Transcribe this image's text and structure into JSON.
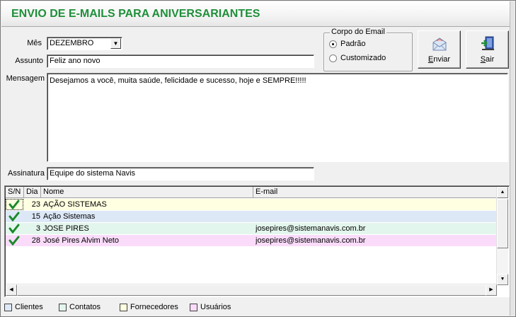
{
  "header": {
    "title": "ENVIO DE E-MAILS PARA ANIVERSARIANTES"
  },
  "form": {
    "mes_label": "Mês",
    "mes_value": "DEZEMBRO",
    "assunto_label": "Assunto",
    "assunto_value": "Feliz ano novo",
    "mensagem_label": "Mensagem",
    "mensagem_value": "Desejamos a você, muita saúde, felicidade e sucesso, hoje e SEMPRE!!!!!",
    "assinatura_label": "Assinatura",
    "assinatura_value": "Equipe do sistema Navis"
  },
  "corpo": {
    "title": "Corpo do Email",
    "options": [
      {
        "label": "Padrão",
        "checked": true
      },
      {
        "label": "Customizado",
        "checked": false
      }
    ]
  },
  "buttons": {
    "enviar_first": "E",
    "enviar_rest": "nviar",
    "sair_first": "S",
    "sair_rest": "air"
  },
  "table": {
    "columns": [
      "S/N",
      "Dia",
      "Nome",
      "E-mail"
    ],
    "rows": [
      {
        "checked": true,
        "dia": "23",
        "nome": "AÇÃO SISTEMAS",
        "email": "",
        "category": "Fornecedores",
        "bg": "#ffffe1"
      },
      {
        "checked": true,
        "dia": "15",
        "nome": "Ação Sistemas",
        "email": "",
        "category": "Clientes",
        "bg": "#dde8f7"
      },
      {
        "checked": true,
        "dia": "3",
        "nome": "JOSE PIRES",
        "email": "josepires@sistemanavis.com.br",
        "category": "Contatos",
        "bg": "#e3f6ed"
      },
      {
        "checked": true,
        "dia": "28",
        "nome": "José Pires Alvim Neto",
        "email": "josepires@sistemanavis.com.br",
        "category": "Usuários",
        "bg": "#fadcfa"
      }
    ]
  },
  "legend": [
    {
      "label": "Clientes",
      "color": "#dde8f7"
    },
    {
      "label": "Contatos",
      "color": "#e3f6ed"
    },
    {
      "label": "Fornecedores",
      "color": "#ffffe1"
    },
    {
      "label": "Usuários",
      "color": "#fadcfa"
    }
  ],
  "colors": {
    "title": "#1f8f3a",
    "check": "#1a8a2a"
  },
  "icons": {
    "enviar": "envelope-icon",
    "sair": "exit-door-icon",
    "check": "checkmark-icon"
  }
}
